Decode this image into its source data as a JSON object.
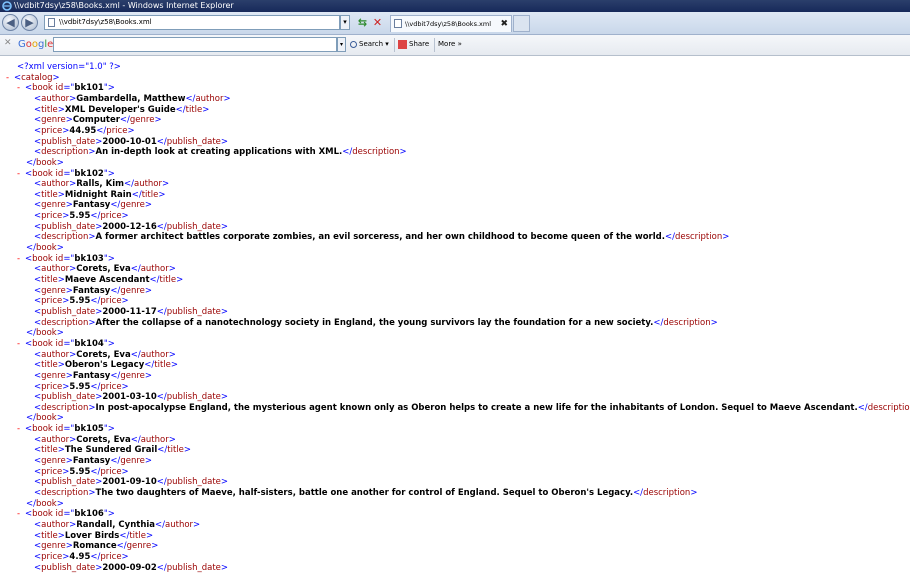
{
  "window": {
    "title": "\\\\vdbit7dsy\\z58\\Books.xml - Windows Internet Explorer"
  },
  "nav": {
    "back_label": "◀",
    "forward_label": "▶",
    "address": "\\\\vdbit7dsy\\z58\\Books.xml",
    "tab_title": "\\\\vdbit7dsy\\z58\\Books.xml",
    "tab_close": "✖"
  },
  "google": {
    "close": "✕",
    "logo": "Google",
    "search_value": "",
    "search_label": "Search",
    "share_label": "Share",
    "more_label": "More »"
  },
  "xml": {
    "declaration": "<?xml version=\"1.0\" ?>",
    "root_open": "catalog",
    "books": [
      {
        "id": "bk101",
        "author": "Gambardella, Matthew",
        "title": "XML Developer's Guide",
        "genre": "Computer",
        "price": "44.95",
        "publish_date": "2000-10-01",
        "description": "An in-depth look at creating applications with XML."
      },
      {
        "id": "bk102",
        "author": "Ralls, Kim",
        "title": "Midnight Rain",
        "genre": "Fantasy",
        "price": "5.95",
        "publish_date": "2000-12-16",
        "description": "A former architect battles corporate zombies, an evil sorceress, and her own childhood to become queen of the world."
      },
      {
        "id": "bk103",
        "author": "Corets, Eva",
        "title": "Maeve Ascendant",
        "genre": "Fantasy",
        "price": "5.95",
        "publish_date": "2000-11-17",
        "description": "After the collapse of a nanotechnology society in England, the young survivors lay the foundation for a new society."
      },
      {
        "id": "bk104",
        "author": "Corets, Eva",
        "title": "Oberon's Legacy",
        "genre": "Fantasy",
        "price": "5.95",
        "publish_date": "2001-03-10",
        "description": "In post-apocalypse England, the mysterious agent known only as Oberon helps to create a new life for the inhabitants of London. Sequel to Maeve Ascendant."
      },
      {
        "id": "bk105",
        "author": "Corets, Eva",
        "title": "The Sundered Grail",
        "genre": "Fantasy",
        "price": "5.95",
        "publish_date": "2001-09-10",
        "description": "The two daughters of Maeve, half-sisters, battle one another for control of England. Sequel to Oberon's Legacy."
      },
      {
        "id": "bk106",
        "author": "Randall, Cynthia",
        "title": "Lover Birds",
        "genre": "Romance",
        "price": "4.95",
        "publish_date": "2000-09-02",
        "description": null
      }
    ]
  }
}
